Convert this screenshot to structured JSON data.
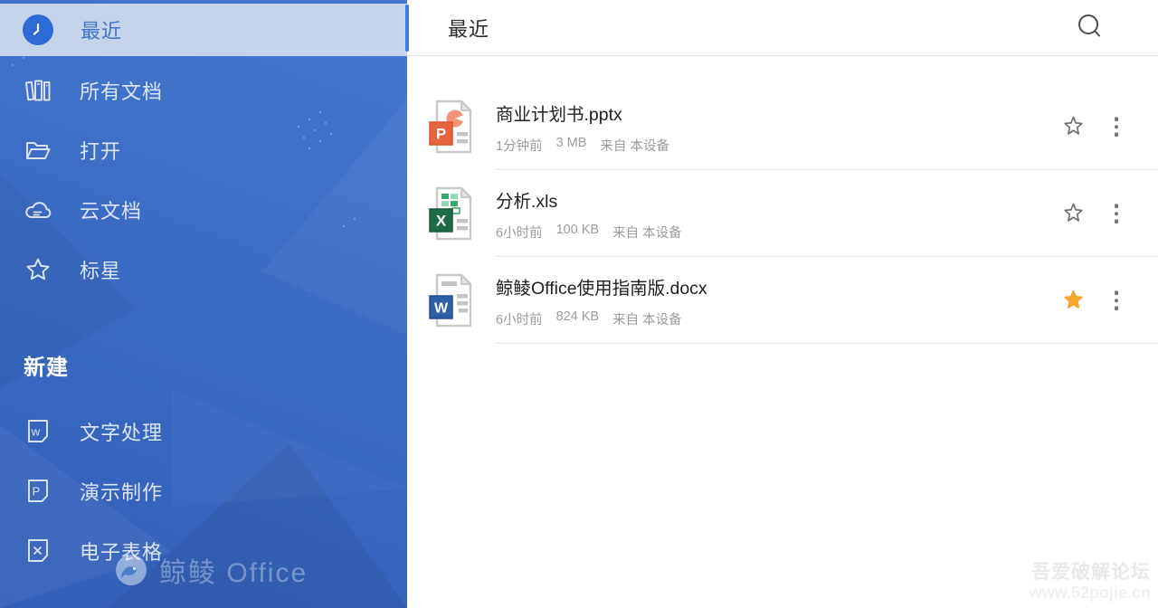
{
  "app_name": "鲸鲮 Office",
  "sidebar": {
    "items": [
      {
        "label": "最近",
        "icon": "clock-icon",
        "selected": true
      },
      {
        "label": "所有文档",
        "icon": "all-documents-icon",
        "selected": false
      },
      {
        "label": "打开",
        "icon": "folder-open-icon",
        "selected": false
      },
      {
        "label": "云文档",
        "icon": "cloud-icon",
        "selected": false
      },
      {
        "label": "标星",
        "icon": "star-outline-icon",
        "selected": false
      }
    ],
    "new_section": {
      "label": "新建",
      "items": [
        {
          "label": "文字处理",
          "icon": "word-doc-icon"
        },
        {
          "label": "演示制作",
          "icon": "presentation-doc-icon"
        },
        {
          "label": "电子表格",
          "icon": "spreadsheet-doc-icon"
        }
      ]
    },
    "brand_watermark": "鲸鲮 Office"
  },
  "header": {
    "title": "最近",
    "search_icon": "search-icon"
  },
  "files": [
    {
      "name": "商业计划书.pptx",
      "type": "pptx",
      "time": "1分钟前",
      "size": "3 MB",
      "origin": "来自 本设备",
      "starred": false
    },
    {
      "name": "分析.xls",
      "type": "xls",
      "time": "6小时前",
      "size": "100 KB",
      "origin": "来自 本设备",
      "starred": false
    },
    {
      "name": "鲸鲮Office使用指南版.docx",
      "type": "docx",
      "time": "6小时前",
      "size": "824 KB",
      "origin": "来自 本设备",
      "starred": true
    }
  ],
  "corner_watermark": {
    "line1": "吾爱破解论坛",
    "line2": "www.52pojie.cn"
  },
  "colors": {
    "sidebar_blue": "#3a6cc4",
    "selected_highlight": "#c6d4eb",
    "selected_text": "#4273c8",
    "scrollbar_thumb": "#3c79e9",
    "star_filled": "#f5a62b",
    "pptx_badge": "#e8643c",
    "xls_badge": "#1b6b47",
    "docx_badge": "#2c60a9"
  }
}
